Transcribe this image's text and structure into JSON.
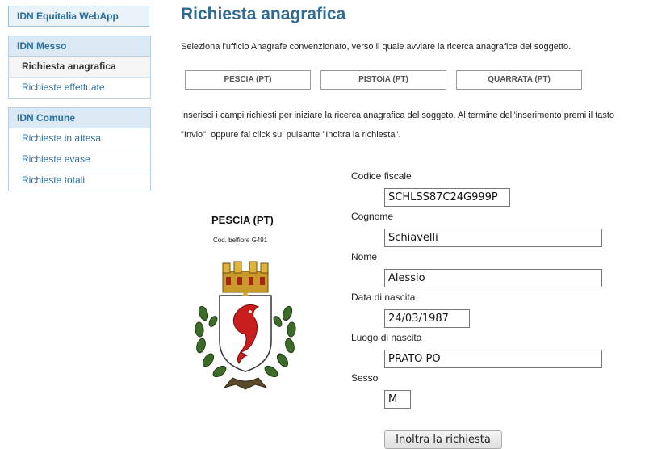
{
  "app": {
    "title": "IDN Equitalia WebApp"
  },
  "sidebar": {
    "groups": [
      {
        "title": "IDN Messo",
        "items": [
          "Richiesta anagrafica",
          "Richieste effettuate"
        ]
      },
      {
        "title": "IDN Comune",
        "items": [
          "Richieste in attesa",
          "Richieste evase",
          "Richieste totali"
        ]
      }
    ]
  },
  "main": {
    "title": "Richiesta anagrafica",
    "intro": "Seleziona l'ufficio Anagrafe convenzionato, verso il quale avviare la ricerca anagrafica del soggetto.",
    "offices": [
      "PESCIA (PT)",
      "PISTOIA (PT)",
      "QUARRATA (PT)"
    ],
    "instructions_line1": "Inserisci i campi richiesti per iniziare la ricerca anagrafica del soggeto. Al termine dell'inserimento premi il tasto",
    "instructions_line2": "\"Invio\", oppure fai click sul pulsante \"Inoltra la richiesta\"."
  },
  "municipality": {
    "name": "PESCIA (PT)",
    "code": "Cod. belfiore G491",
    "emblem_icon": "pescia-coat-of-arms"
  },
  "form": {
    "codice_fiscale": {
      "label": "Codice fiscale",
      "value": "SCHLSS87C24G999P"
    },
    "cognome": {
      "label": "Cognome",
      "value": "Schiavelli"
    },
    "nome": {
      "label": "Nome",
      "value": "Alessio"
    },
    "data_nascita": {
      "label": "Data di nascita",
      "value": "24/03/1987"
    },
    "luogo_nascita": {
      "label": "Luogo di nascita",
      "value": "PRATO PO"
    },
    "sesso": {
      "label": "Sesso",
      "value": "M"
    },
    "submit_label": "Inoltra la richiesta"
  },
  "colors": {
    "accent": "#2f6a95",
    "link": "#2a6f9c",
    "menu_head_bg": "#dbe9f4"
  }
}
